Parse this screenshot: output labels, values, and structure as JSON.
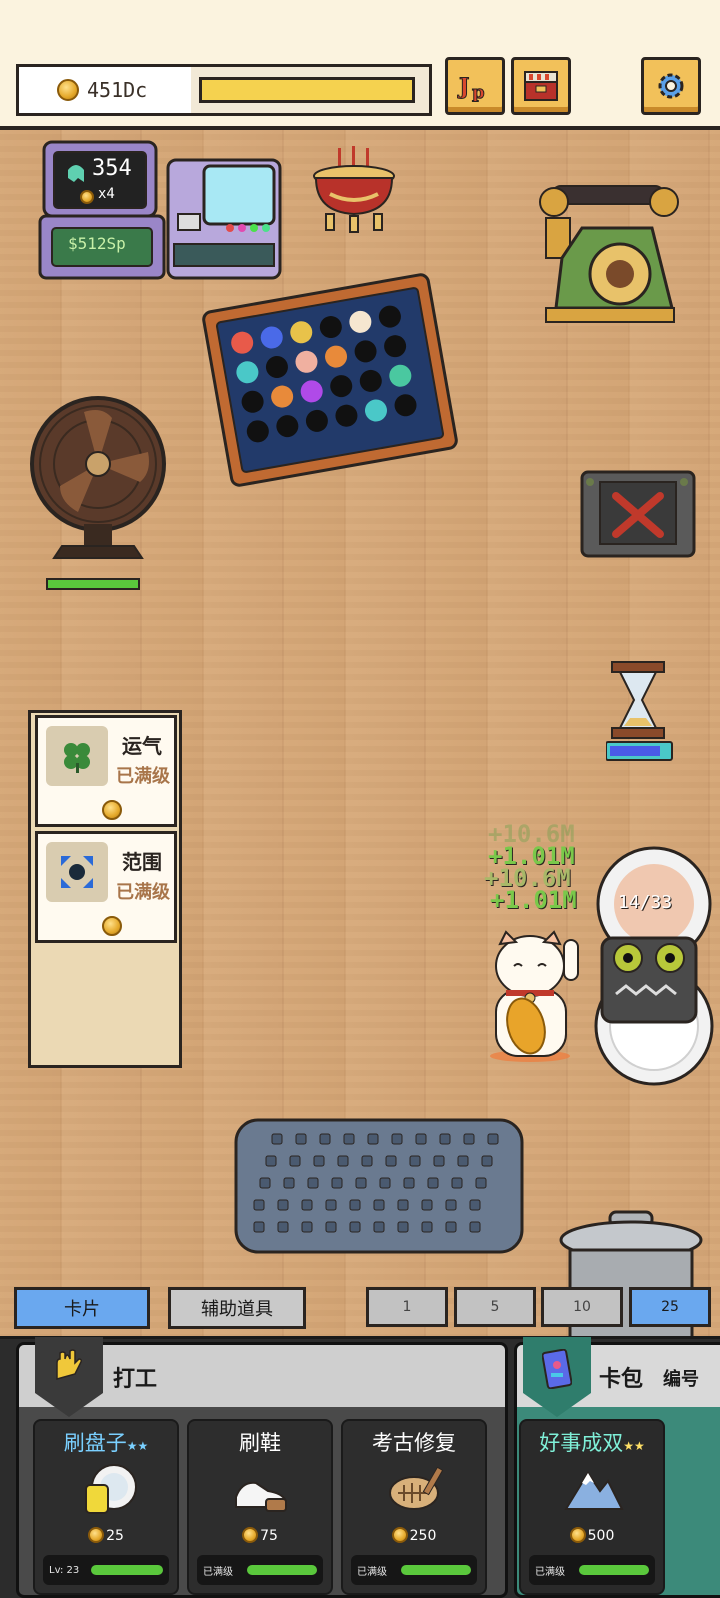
{
  "topbar": {
    "coins": "451Dc",
    "progress": 1.0,
    "jp_label": "JP"
  },
  "machine": {
    "ghost_count": "354",
    "multiplier": "x4",
    "money": "$512Sp"
  },
  "counter_plate": "14/33",
  "floating": [
    "+10.6M",
    "+1.01M",
    "+10.6M",
    "+1.01M"
  ],
  "tools": [
    {
      "name": "运气",
      "status": "已满级",
      "icon": "clover-icon"
    },
    {
      "name": "范围",
      "status": "已满级",
      "icon": "expand-icon"
    }
  ],
  "tabs": {
    "cards": "卡片",
    "aux": "辅助道具"
  },
  "quantities": [
    "1",
    "5",
    "10",
    "25"
  ],
  "active_quantity": "25",
  "work_group": {
    "title": "打工",
    "jobs": [
      {
        "name": "刷盘子",
        "stars": "★★",
        "price": "25",
        "bar_label": "Lv: 23",
        "icon": "plate-sponge-icon"
      },
      {
        "name": "刷鞋",
        "stars": "",
        "price": "75",
        "bar_label": "已满级",
        "icon": "shoe-brush-icon"
      },
      {
        "name": "考古修复",
        "stars": "",
        "price": "250",
        "bar_label": "已满级",
        "icon": "fossil-icon"
      }
    ]
  },
  "pack_group": {
    "title": "卡包",
    "sub": "编号",
    "jobs": [
      {
        "name": "好事成双",
        "stars": "★★",
        "price": "500",
        "bar_label": "已满级",
        "icon": "mountain-icon"
      }
    ]
  },
  "colors": {
    "accent_blue": "#6aa8ef",
    "coin_gold": "#e5a92b",
    "progress_green": "#5ac83c"
  }
}
